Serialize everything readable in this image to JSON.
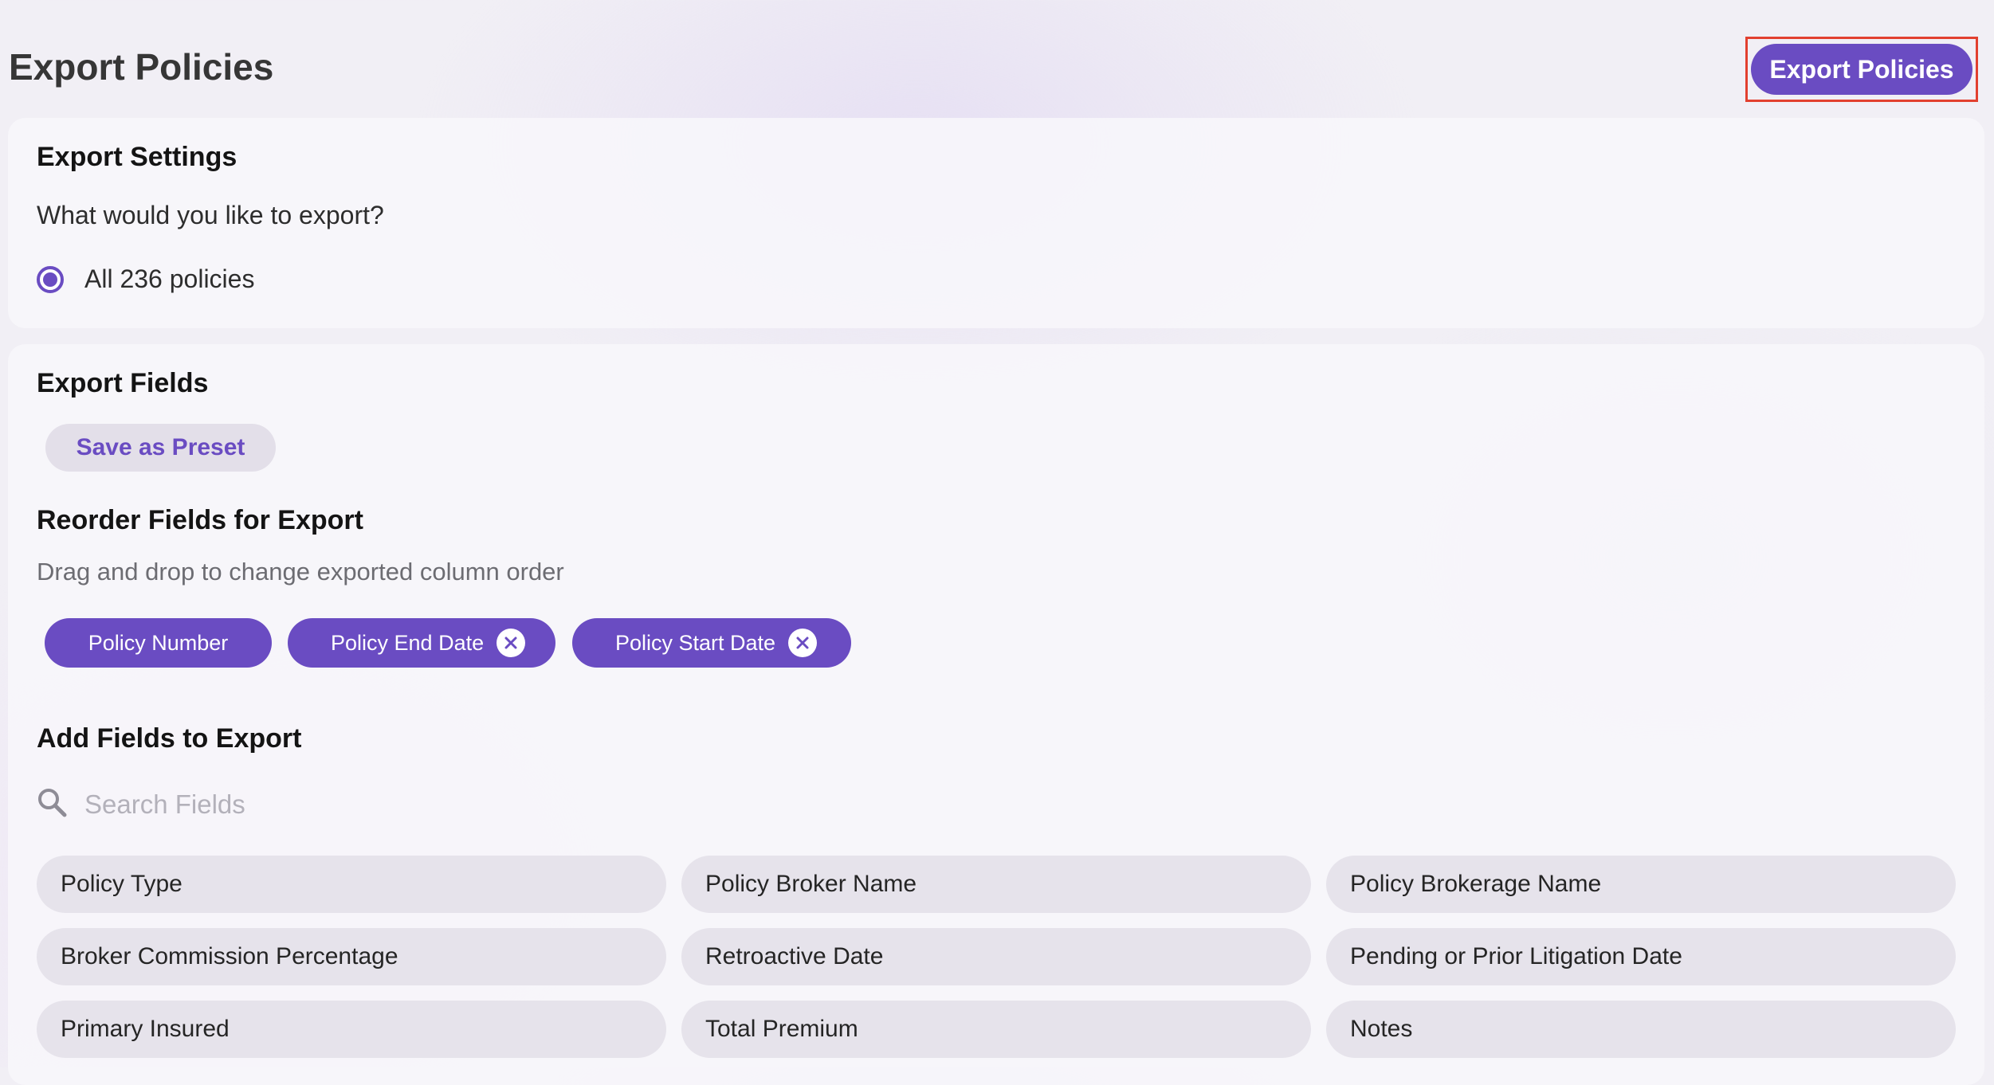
{
  "header": {
    "title": "Export Policies",
    "export_button_label": "Export Policies"
  },
  "settings": {
    "title": "Export Settings",
    "question": "What would you like to export?",
    "option_label": "All 236 policies",
    "option_selected": true
  },
  "fields": {
    "title": "Export Fields",
    "save_preset_label": "Save as Preset",
    "reorder": {
      "title": "Reorder Fields for Export",
      "hint": "Drag and drop to change exported column order",
      "selected": [
        {
          "label": "Policy Number",
          "removable": false
        },
        {
          "label": "Policy End Date",
          "removable": true
        },
        {
          "label": "Policy Start Date",
          "removable": true
        }
      ]
    },
    "add": {
      "title": "Add Fields to Export",
      "search_placeholder": "Search Fields",
      "search_value": "",
      "available": [
        "Policy Type",
        "Policy Broker Name",
        "Policy Brokerage Name",
        "Broker Commission Percentage",
        "Retroactive Date",
        "Pending or Prior Litigation Date",
        "Primary Insured",
        "Total Premium",
        "Notes"
      ]
    }
  },
  "colors": {
    "accent": "#6a4cc2",
    "highlight_border": "#e2402f",
    "chip_bg": "#e6e3eb",
    "preset_bg": "#e3dfe9"
  },
  "icons": {
    "search": "search-icon",
    "close": "close-circle-icon",
    "radio": "radio-selected-icon"
  }
}
